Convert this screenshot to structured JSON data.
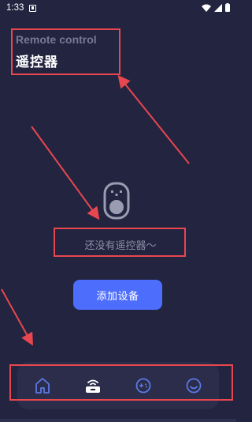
{
  "status_bar": {
    "time": "1:33"
  },
  "header": {
    "subtitle": "Remote control",
    "title": "遥控器"
  },
  "empty_state": {
    "message": "还没有遥控器～",
    "icon": "remote-icon"
  },
  "add_button": {
    "label": "添加设备"
  },
  "bottom_nav": {
    "items": [
      {
        "icon": "home-icon",
        "active": false
      },
      {
        "icon": "router-icon",
        "active": true
      },
      {
        "icon": "game-controller-icon",
        "active": false
      },
      {
        "icon": "smiley-icon",
        "active": false
      }
    ]
  },
  "colors": {
    "background": "#232440",
    "accent": "#4d6efc",
    "annotation": "#e8474f",
    "nav_inactive": "#5b78e6"
  }
}
